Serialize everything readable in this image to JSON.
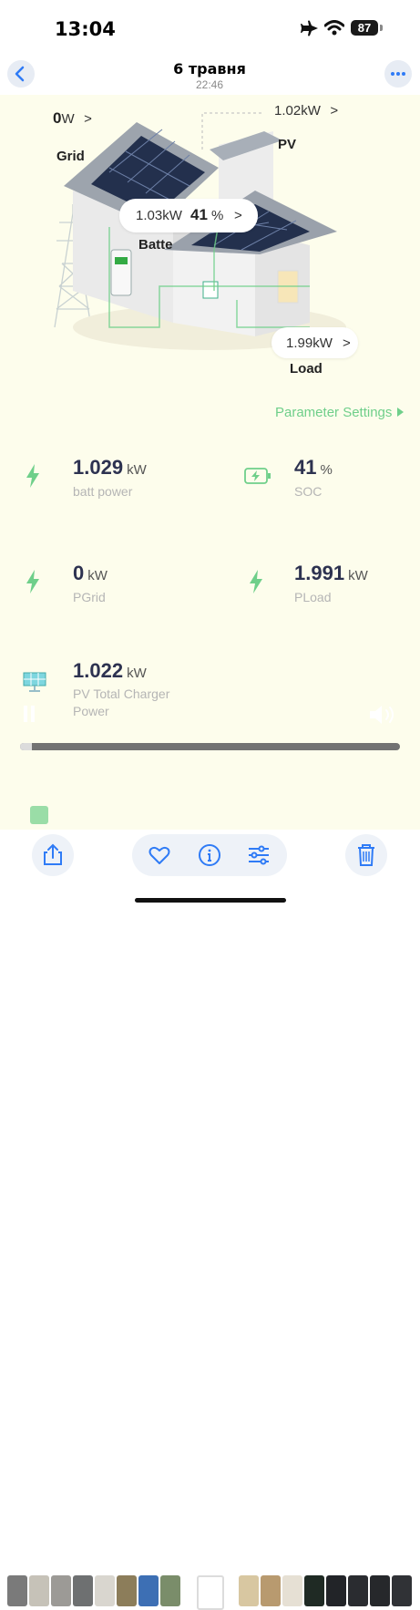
{
  "status": {
    "time": "13:04",
    "battery": "87"
  },
  "nav": {
    "title": "6 травня",
    "subtitle": "22:46"
  },
  "flow": {
    "grid_value": "0",
    "grid_unit": "W",
    "grid_label": "Grid",
    "pv_value": "1.02kW",
    "pv_label": "PV",
    "battery_power": "1.03kW",
    "battery_soc": "41",
    "battery_soc_unit": "%",
    "battery_label": "Batte",
    "load_value": "1.99kW",
    "load_label": "Load",
    "chevron": ">"
  },
  "parameter_settings": "Parameter Settings",
  "metrics": [
    {
      "value": "1.029",
      "unit": "kW",
      "label": "batt power",
      "icon": "lightning-icon"
    },
    {
      "value": "41",
      "unit": "%",
      "label": "SOC",
      "icon": "battery-charging-icon"
    },
    {
      "value": "0",
      "unit": "kW",
      "label": "PGrid",
      "icon": "lightning-icon"
    },
    {
      "value": "1.991",
      "unit": "kW",
      "label": "PLoad",
      "icon": "lightning-icon"
    },
    {
      "value": "1.022",
      "unit": "kW",
      "label": "PV Total Charger",
      "label2": "Power",
      "icon": "solar-panel-icon"
    }
  ],
  "video": {
    "progress": 0.03
  },
  "colors": {
    "accent_green": "#6fcf8a",
    "ios_blue": "#2f7bf6",
    "value_navy": "#2d3250"
  }
}
